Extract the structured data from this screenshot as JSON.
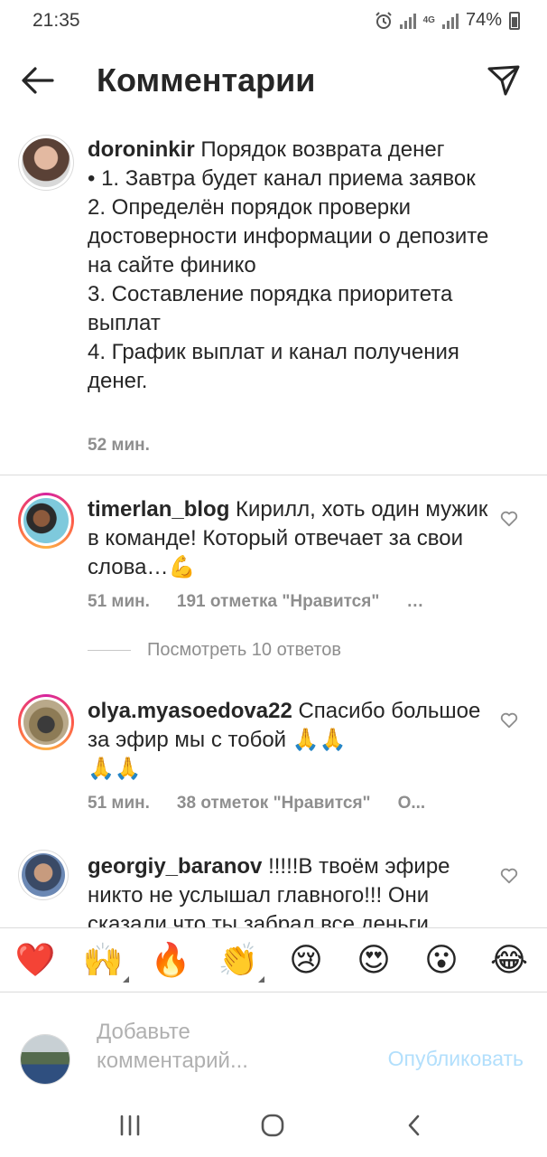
{
  "status": {
    "time": "21:35",
    "network": "4G",
    "battery": "74%"
  },
  "header": {
    "title": "Комментарии"
  },
  "caption": {
    "username": "doroninkir",
    "text": " Порядок возврата денег\n• 1. Завтра будет канал приема заявок\n2. Определён порядок проверки достоверности информации о депозите на сайте финико\n3. Составление порядка приоритета выплат\n4. График выплат и канал получения денег.",
    "time": "52 мин."
  },
  "comments": [
    {
      "username": "timerlan_blog",
      "text": " Кирилл, хоть один мужик в команде! Который отвечает за свои слова…💪",
      "time": "51 мин.",
      "likes": "191 отметка \"Нравится\"",
      "extra": "…"
    },
    {
      "username": "olya.myasoedova22",
      "text": " Спасибо большое за эфир мы с тобой 🙏🙏\n🙏🙏",
      "time": "51 мин.",
      "likes": "38 отметок \"Нравится\"",
      "extra": "О..."
    },
    {
      "username": "georgiy_baranov",
      "text": " !!!!!В твоём эфире никто не услышал главного!!! Они сказали что ты забрал все деньги",
      "time": "",
      "likes": "",
      "extra": ""
    }
  ],
  "view_replies": "Посмотреть 10 ответов",
  "emoji_bar": [
    "❤️",
    "🙌",
    "🔥",
    "👏",
    "😢",
    "😍",
    "😮",
    "😂"
  ],
  "composer": {
    "placeholder": "Добавьте комментарий...",
    "publish_label": "Опубликовать"
  },
  "icons": {
    "back": "arrow-left-icon",
    "send": "paper-plane-icon",
    "like": "heart-outline-icon",
    "nav_recent": "recent-apps-icon",
    "nav_home": "home-icon",
    "nav_back": "chevron-left-icon"
  }
}
